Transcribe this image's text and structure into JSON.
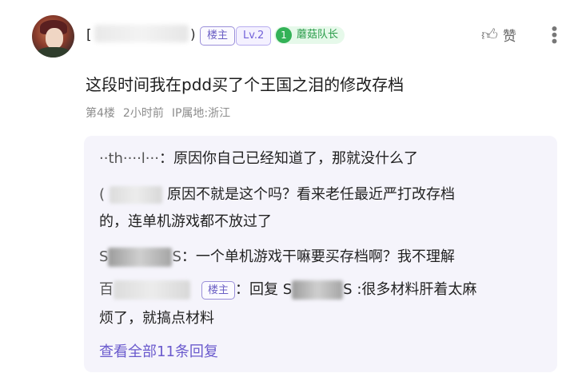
{
  "post": {
    "username_start": "[",
    "username_end": ")",
    "owner_badge": "楼主",
    "level_badge": "Lv.2",
    "role_number": "1",
    "role_badge": "蘑菇队长",
    "like_label": "赞",
    "more_label": "⋮",
    "content": "这段时间我在pdd买了个王国之泪的修改存档",
    "floor": "第4楼",
    "time": "2小时前",
    "ip": "IP属地:浙江"
  },
  "replies": [
    {
      "name": "··th····l···",
      "text": "：原因你自己已经知道了，那就没什么了"
    },
    {
      "name": "(",
      "text": "原因不就是这个吗？看来老任最近严打改存档",
      "text2": "的，连单机游戏都不放过了"
    },
    {
      "name_start": "S",
      "name_end": "S",
      "text": "：一个单机游戏干嘛要买存档啊？我不理解"
    },
    {
      "name_start": "百",
      "badge": "楼主",
      "text": "：回复 S",
      "text_mid": "S :很多材料肝着太麻",
      "text2": "烦了，就搞点材料"
    }
  ],
  "view_all": "查看全部11条回复",
  "colors": {
    "accent": "#6a5acd",
    "role_green": "#33b257",
    "reply_bg": "#f5f4fb"
  }
}
